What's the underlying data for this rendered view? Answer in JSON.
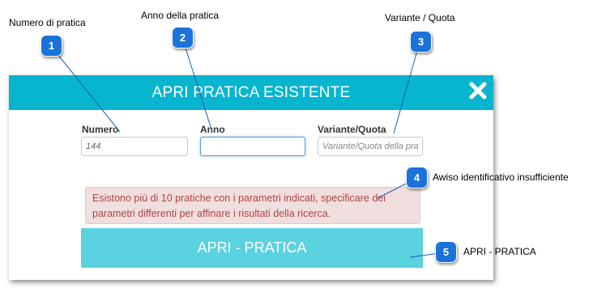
{
  "dialog": {
    "title": "APRI PRATICA ESISTENTE",
    "close_icon": "close-icon",
    "fields": [
      {
        "label": "Numero",
        "value": "144",
        "placeholder": ""
      },
      {
        "label": "Anno",
        "value": "",
        "placeholder": ""
      },
      {
        "label": "Variante/Quota",
        "value": "",
        "placeholder": "Variante/Quota della pratica"
      }
    ],
    "alert": {
      "line1": "Esistono più di 10 pratiche con i parametri indicati, specificare dei",
      "line2": "parametri differenti per affinare i risultati della ricerca."
    },
    "open_button_label": "APRI - PRATICA"
  },
  "callouts": [
    {
      "number": "1",
      "label": "Numero di pratica"
    },
    {
      "number": "2",
      "label": "Anno della pratica"
    },
    {
      "number": "3",
      "label": "Variante / Quota"
    },
    {
      "number": "4",
      "label": "Awiso identificativo insufficiente"
    },
    {
      "number": "5",
      "label": "APRI - PRATICA"
    }
  ],
  "colors": {
    "header": "#08b5cf",
    "button": "#5bd2e0",
    "alert_bg": "#f1dede",
    "alert_text": "#b04444",
    "badge": "#1a73d9"
  }
}
